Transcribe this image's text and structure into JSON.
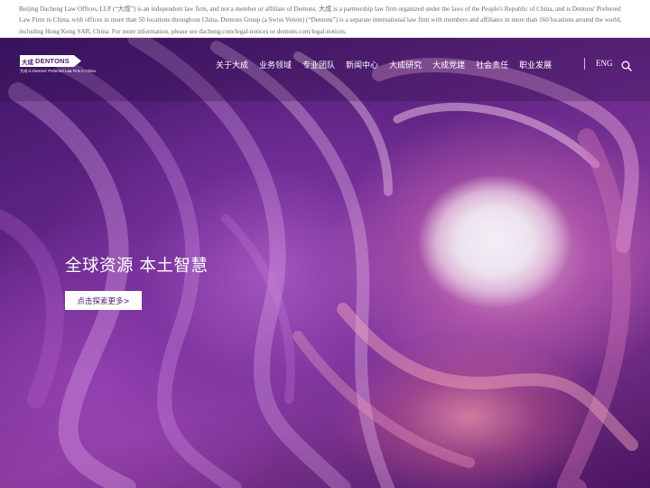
{
  "disclaimer": {
    "text": "Beijing Dacheng Law Offices, LLP (“大成”) is an independent law firm, and not a member or affiliate of Dentons. 大成 is a partnership law firm organized under the laws of the People's Republic of China, and is Dentons' Preferred Law Firm in China, with offices in more than 50 locations throughout China. Dentons Group (a Swiss Verein) (“Dentons”) is a separate international law firm with members and affiliates in more than 160 locations around the world, including Hong Kong SAR, China. For more information, please see dacheng.com/legal-notices or dentons.com/legal-notices."
  },
  "header": {
    "logo_mark": "大成",
    "logo_word": "DENTONS",
    "logo_tagline": "大成 is Dentons' Preferred Law Firm in China.",
    "nav": [
      {
        "label": "关于大成"
      },
      {
        "label": "业务领域"
      },
      {
        "label": "专业团队"
      },
      {
        "label": "新闻中心"
      },
      {
        "label": "大成研究"
      },
      {
        "label": "大成党建"
      },
      {
        "label": "社会责任"
      },
      {
        "label": "职业发展"
      }
    ],
    "language": "ENG",
    "search_icon": "search-icon"
  },
  "hero": {
    "headline": "全球资源 本土智慧",
    "cta_label": "点击探索更多>"
  },
  "colors": {
    "brand_purple": "#4b1c72",
    "nav_text": "#ffffff"
  }
}
